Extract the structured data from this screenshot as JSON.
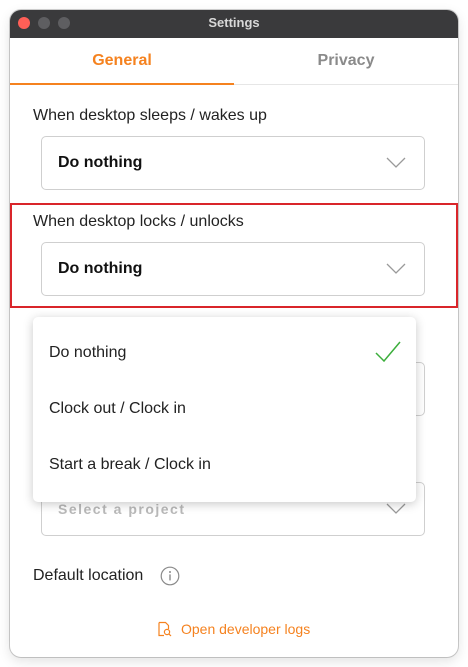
{
  "window": {
    "title": "Settings"
  },
  "tabs": [
    {
      "label": "General",
      "active": true
    },
    {
      "label": "Privacy",
      "active": false
    }
  ],
  "settings": {
    "sleep_wake": {
      "label": "When desktop sleeps / wakes up",
      "value": "Do nothing"
    },
    "lock_unlock": {
      "label": "When desktop locks / unlocks",
      "value": "Do nothing"
    },
    "project": {
      "placeholder": "Select a project"
    },
    "default_location": {
      "label": "Default location"
    }
  },
  "dropdown": {
    "options": [
      {
        "label": "Do nothing",
        "selected": true
      },
      {
        "label": "Clock out / Clock in",
        "selected": false
      },
      {
        "label": "Start a break / Clock in",
        "selected": false
      }
    ]
  },
  "footer": {
    "dev_logs_label": "Open developer logs"
  },
  "colors": {
    "accent": "#f5821f",
    "highlight_border": "#d9252a",
    "check": "#3cae3c",
    "titlebar": "#3a3a3c"
  }
}
